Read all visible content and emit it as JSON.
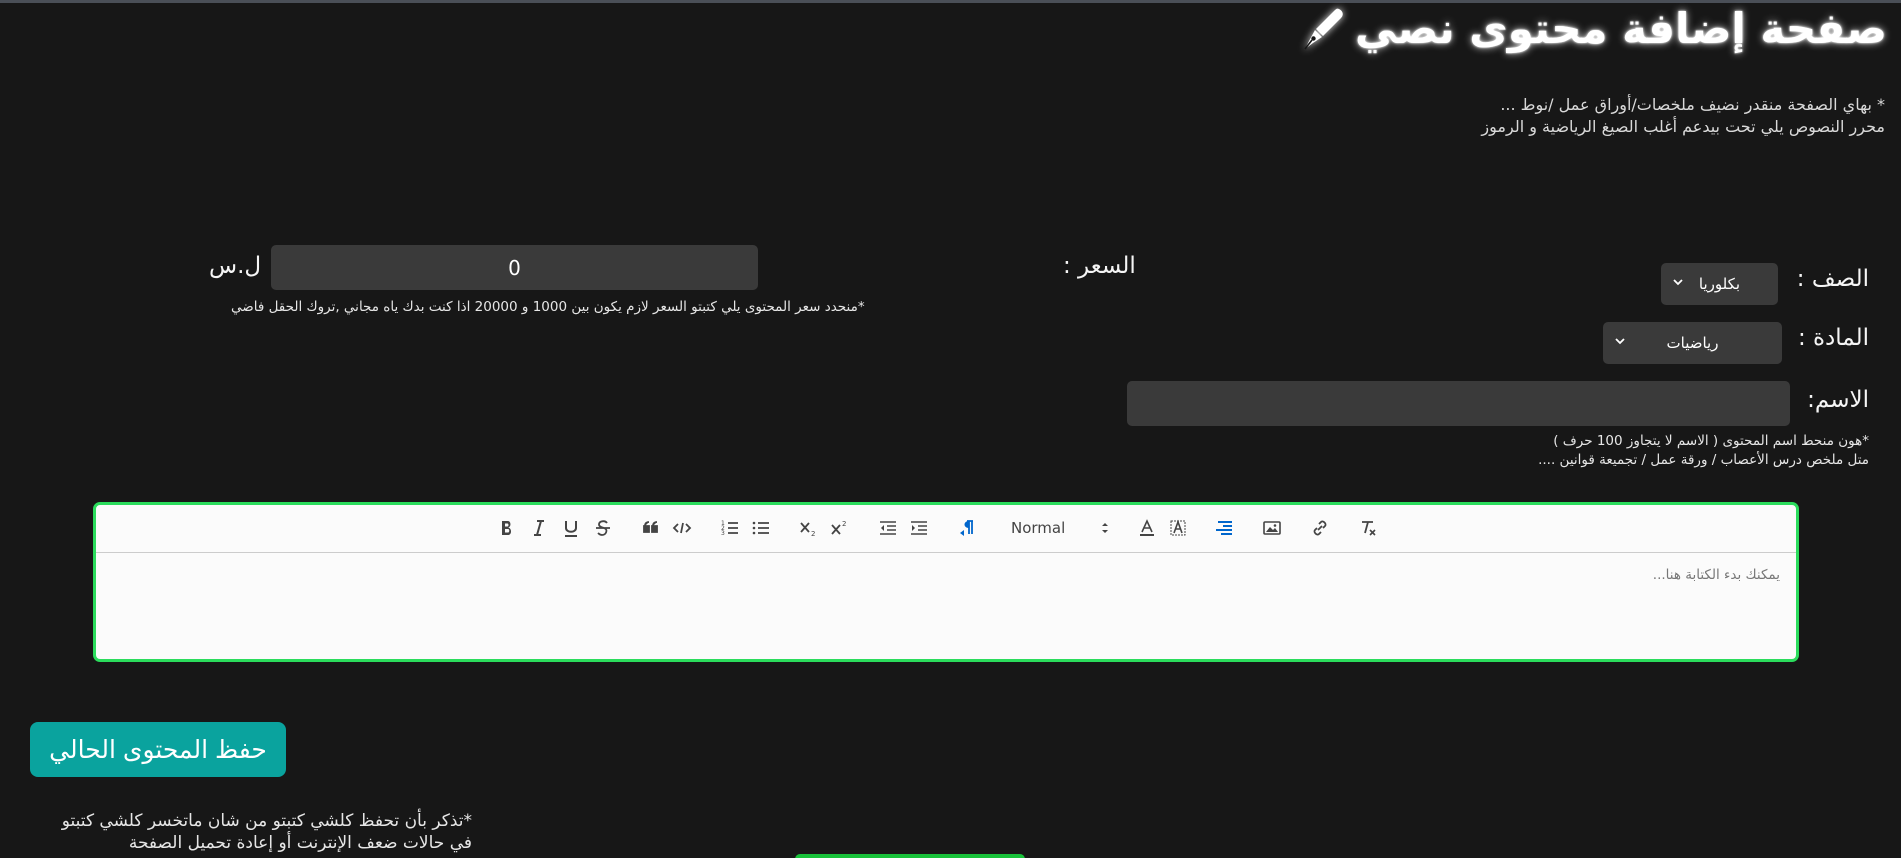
{
  "page": {
    "title": "صفحة إضافة محتوى نصي",
    "title_icon": "pen-icon",
    "intro_line1": "* بهاي الصفحة منقدر نضيف ملخصات/أوراق عمل /نوط ...",
    "intro_line2": "محرر النصوص يلي تحت بيدعم أغلب الصيغ الرياضية و الرموز"
  },
  "form": {
    "grade_label": "الصف :",
    "grade_value": "بكلوريا",
    "subject_label": "المادة :",
    "subject_value": "رياضيات",
    "name_label": "الاسم:",
    "name_value": "",
    "name_hint_line1": "*هون منحط اسم المحتوى ( الاسم لا يتجاوز 100 حرف )",
    "name_hint_line2": "متل ملخص درس الأعصاب / ورقة عمل / تجميعة قوانين ....",
    "price_label": "السعر :",
    "price_value": "0",
    "price_currency": "ل.س",
    "price_hint": "*منحدد سعر المحتوى يلي كتبتو السعر لازم يكون بين 1000 و 20000 اذا كنت بدك ياه مجاني ,تروك الحقل فاضي"
  },
  "editor": {
    "header_picker": "Normal",
    "placeholder": "يمكنك بدء الكتابة هنا...",
    "border_color": "#2bdc5c",
    "tools": [
      "bold-icon",
      "italic-icon",
      "underline-icon",
      "strike-icon",
      "blockquote-icon",
      "code-block-icon",
      "ordered-list-icon",
      "bullet-list-icon",
      "subscript-icon",
      "superscript-icon",
      "indent-decrease-icon",
      "indent-increase-icon",
      "rtl-direction-icon",
      "header-picker",
      "text-color-icon",
      "background-color-icon",
      "align-right-icon",
      "image-icon",
      "link-icon",
      "clear-format-icon"
    ]
  },
  "actions": {
    "save_label": "حفظ المحتوى الحالي",
    "save_color": "#0aa39e",
    "save_note": "*تذكر بأن تحفظ كلشي كتبتو من شان ماتخسر كلشي كتبتو في حالات ضعف الإنترنت أو إعادة تحميل الصفحة"
  }
}
